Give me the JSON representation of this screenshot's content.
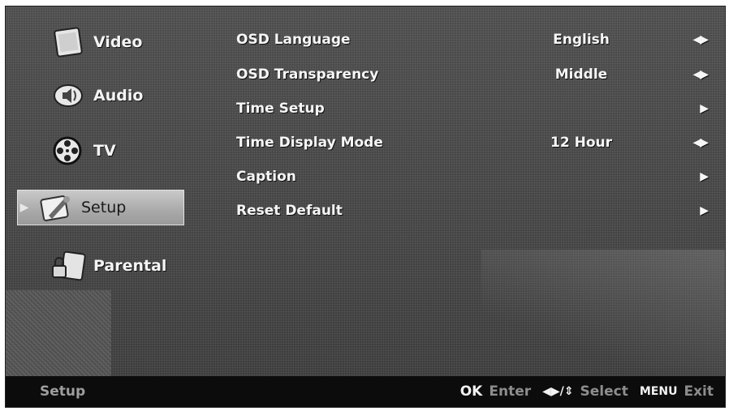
{
  "sidebar": {
    "items": [
      {
        "label": "Video",
        "icon": "video-icon",
        "selected": false
      },
      {
        "label": "Audio",
        "icon": "audio-icon",
        "selected": false
      },
      {
        "label": "TV",
        "icon": "tv-reel-icon",
        "selected": false
      },
      {
        "label": "Setup",
        "icon": "setup-icon",
        "selected": true
      },
      {
        "label": "Parental",
        "icon": "parental-lock-icon",
        "selected": false
      }
    ]
  },
  "menu": {
    "rows": [
      {
        "name": "OSD Language",
        "value": "English",
        "control": "◀▶"
      },
      {
        "name": "OSD Transparency",
        "value": "Middle",
        "control": "◀▶"
      },
      {
        "name": "Time Setup",
        "value": "",
        "control": "▶"
      },
      {
        "name": "Time Display Mode",
        "value": "12 Hour",
        "control": "◀▶"
      },
      {
        "name": "Caption",
        "value": "",
        "control": "▶"
      },
      {
        "name": "Reset Default",
        "value": "",
        "control": "▶"
      }
    ]
  },
  "bottombar": {
    "title": "Setup",
    "ok_key": "OK",
    "ok_label": "Enter",
    "nav_key": "◀▶/⇕",
    "nav_label": "Select",
    "menu_key": "MENU",
    "menu_label": "Exit"
  },
  "colors": {
    "background": "#444444",
    "selected_bg": "#b5b5b5",
    "bottombar_bg": "#0c0c0c",
    "text": "#f4f4f4"
  }
}
